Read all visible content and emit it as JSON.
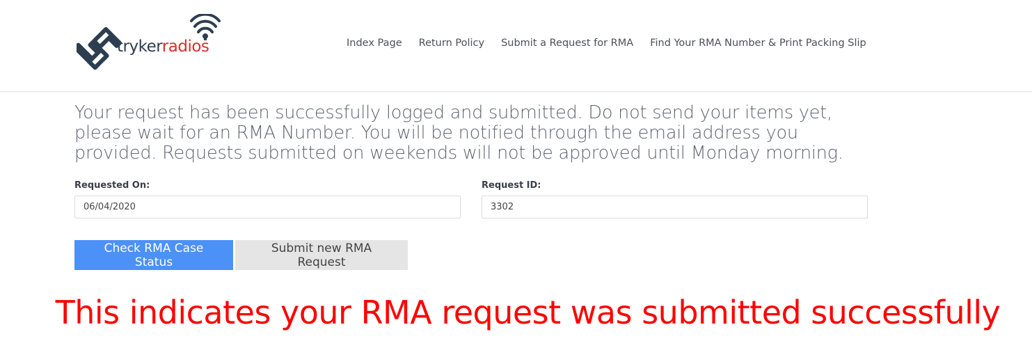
{
  "brand": {
    "logo_part1": "tryker",
    "logo_part2": "radios",
    "primary_color": "#2c3e50",
    "accent_color": "#e02b2b"
  },
  "nav": {
    "items": [
      {
        "label": "Index Page"
      },
      {
        "label": "Return Policy"
      },
      {
        "label": "Submit a Request for RMA"
      },
      {
        "label": "Find Your RMA Number & Print Packing Slip"
      }
    ]
  },
  "main": {
    "message": "Your request has been successfully logged and submitted. Do not send your items yet, please wait for an RMA Number. You will be notified through the email address you provided. Requests submitted on weekends will not be approved until Monday morning.",
    "requested_on": {
      "label": "Requested On:",
      "value": "06/04/2020"
    },
    "request_id": {
      "label": "Request ID:",
      "value": "3302"
    },
    "buttons": {
      "check_status": "Check RMA Case Status",
      "submit_new": "Submit new RMA Request"
    },
    "button_color": "#4b91f7"
  },
  "annotation": {
    "text": "This indicates your RMA request was submitted successfully",
    "color": "#ff0000"
  }
}
